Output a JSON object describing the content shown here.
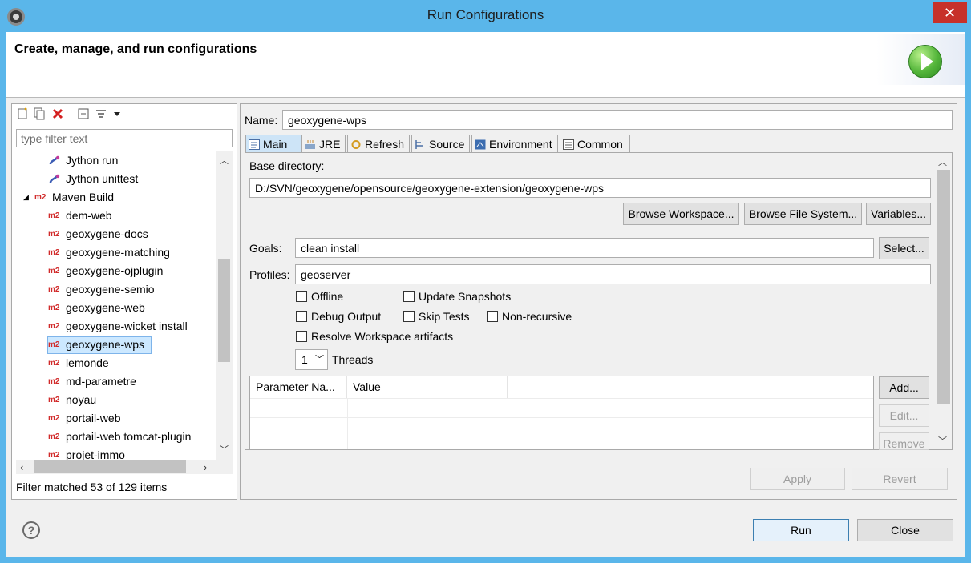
{
  "window": {
    "title": "Run Configurations",
    "close_label": "✕"
  },
  "header": {
    "title": "Create, manage, and run configurations"
  },
  "left": {
    "filter_placeholder": "type filter text",
    "tree": [
      {
        "label": "Jython run",
        "icon": "jython-run-icon",
        "indent": 1
      },
      {
        "label": "Jython unittest",
        "icon": "jython-unittest-icon",
        "indent": 1
      },
      {
        "label": "Maven Build",
        "icon": "m2",
        "indent": 0,
        "expanded": true
      },
      {
        "label": "dem-web",
        "icon": "m2",
        "indent": 1
      },
      {
        "label": "geoxygene-docs",
        "icon": "m2",
        "indent": 1
      },
      {
        "label": "geoxygene-matching",
        "icon": "m2",
        "indent": 1
      },
      {
        "label": "geoxygene-ojplugin",
        "icon": "m2",
        "indent": 1
      },
      {
        "label": "geoxygene-semio",
        "icon": "m2",
        "indent": 1
      },
      {
        "label": "geoxygene-web",
        "icon": "m2",
        "indent": 1
      },
      {
        "label": "geoxygene-wicket install",
        "icon": "m2",
        "indent": 1
      },
      {
        "label": "geoxygene-wps",
        "icon": "m2",
        "indent": 1,
        "selected": true
      },
      {
        "label": "lemonde",
        "icon": "m2",
        "indent": 1
      },
      {
        "label": "md-parametre",
        "icon": "m2",
        "indent": 1
      },
      {
        "label": "noyau",
        "icon": "m2",
        "indent": 1
      },
      {
        "label": "portail-web",
        "icon": "m2",
        "indent": 1
      },
      {
        "label": "portail-web tomcat-plugin",
        "icon": "m2",
        "indent": 1
      },
      {
        "label": "projet-immo",
        "icon": "m2",
        "indent": 1
      }
    ],
    "m2_text": "m2",
    "filter_status": "Filter matched 53 of 129 items"
  },
  "main": {
    "name_label": "Name:",
    "name_value": "geoxygene-wps",
    "tabs": [
      {
        "label": "Main",
        "icon": "main-tab-icon",
        "active": true
      },
      {
        "label": "JRE",
        "icon": "jre-icon"
      },
      {
        "label": "Refresh",
        "icon": "refresh-icon"
      },
      {
        "label": "Source",
        "icon": "source-icon"
      },
      {
        "label": "Environment",
        "icon": "environment-icon"
      },
      {
        "label": "Common",
        "icon": "common-icon"
      }
    ],
    "base_dir_label": "Base directory:",
    "base_dir_value": "D:/SVN/geoxygene/opensource/geoxygene-extension/geoxygene-wps",
    "browse_workspace": "Browse Workspace...",
    "browse_fs": "Browse File System...",
    "variables": "Variables...",
    "goals_label": "Goals:",
    "goals_value": "clean install",
    "select_label": "Select...",
    "profiles_label": "Profiles:",
    "profiles_value": "geoserver",
    "checkboxes": {
      "offline": "Offline",
      "update_snapshots": "Update Snapshots",
      "debug_output": "Debug Output",
      "skip_tests": "Skip Tests",
      "non_recursive": "Non-recursive",
      "resolve_workspace": "Resolve Workspace artifacts"
    },
    "threads_value": "1",
    "threads_label": "Threads",
    "table": {
      "col_param": "Parameter Na...",
      "col_value": "Value"
    },
    "add": "Add...",
    "edit": "Edit...",
    "remove": "Remove",
    "apply": "Apply",
    "revert": "Revert"
  },
  "footer": {
    "help": "?",
    "run": "Run",
    "close": "Close"
  }
}
